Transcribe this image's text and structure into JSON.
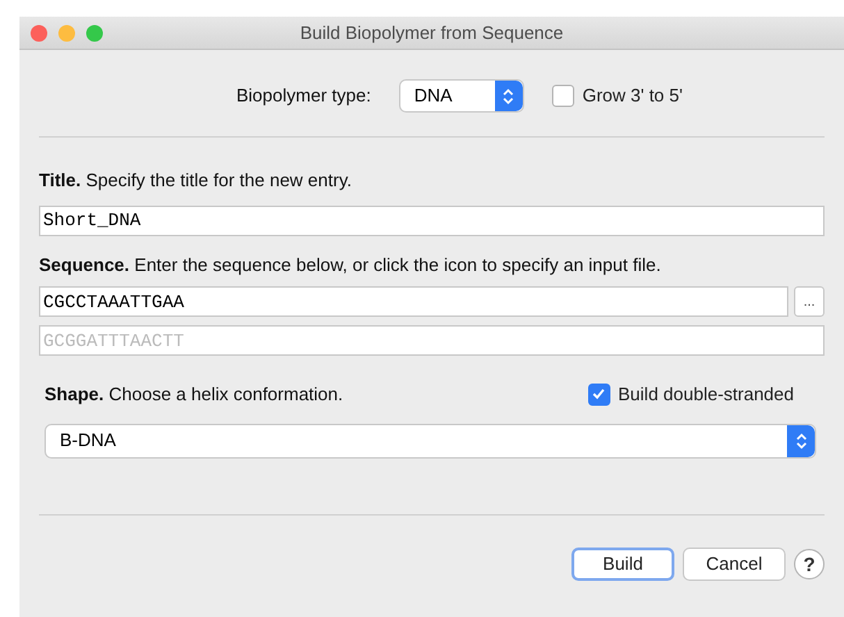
{
  "window": {
    "title": "Build Biopolymer from Sequence"
  },
  "type_row": {
    "label": "Biopolymer type:",
    "value": "DNA",
    "grow": {
      "label": "Grow 3' to 5'",
      "checked": false
    }
  },
  "title_section": {
    "heading": "Title.",
    "text": "Specify the title for the new entry.",
    "value": "Short_DNA"
  },
  "sequence_section": {
    "heading": "Sequence.",
    "text": "Enter the sequence below, or click the icon to specify an input file.",
    "value": "CGCCTAAATTGAA",
    "browse": "...",
    "complement": {
      "value": "GCGGATTTAACTT",
      "disabled": true
    }
  },
  "shape_section": {
    "heading": "Shape.",
    "text": "Choose a helix conformation.",
    "double": {
      "label": "Build double-stranded",
      "checked": true
    },
    "value": "B-DNA"
  },
  "buttons": [
    {
      "label": "Build",
      "kind": "default"
    },
    {
      "label": "Cancel",
      "kind": "normal"
    },
    {
      "label": "?",
      "kind": "help"
    }
  ]
}
